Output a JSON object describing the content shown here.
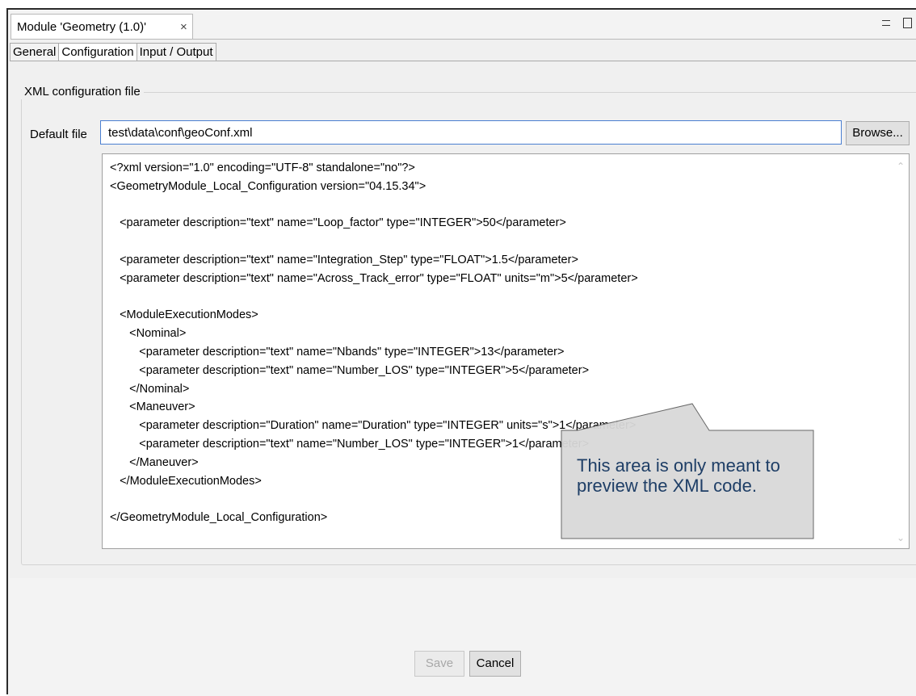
{
  "editor": {
    "tab_title": "Module 'Geometry (1.0)'",
    "close_symbol": "×"
  },
  "subtabs": [
    {
      "label": "General",
      "active": false
    },
    {
      "label": "Configuration",
      "active": true
    },
    {
      "label": "Input / Output",
      "active": false
    }
  ],
  "config": {
    "group_title": "XML configuration file",
    "default_file_label": "Default file",
    "default_file_value": "test\\data\\conf\\geoConf.xml",
    "browse_label": "Browse..."
  },
  "xml_preview": {
    "lines": [
      "<?xml version=\"1.0\" encoding=\"UTF-8\" standalone=\"no\"?>",
      "<GeometryModule_Local_Configuration version=\"04.15.34\">",
      "",
      "   <parameter description=\"text\" name=\"Loop_factor\" type=\"INTEGER\">50</parameter>",
      "",
      "   <parameter description=\"text\" name=\"Integration_Step\" type=\"FLOAT\">1.5</parameter>",
      "   <parameter description=\"text\" name=\"Across_Track_error\" type=\"FLOAT\" units=\"m\">5</parameter>",
      "",
      "   <ModuleExecutionModes>",
      "      <Nominal>",
      "         <parameter description=\"text\" name=\"Nbands\" type=\"INTEGER\">13</parameter>",
      "         <parameter description=\"text\" name=\"Number_LOS\" type=\"INTEGER\">5</parameter>",
      "      </Nominal>",
      "      <Maneuver>",
      "         <parameter description=\"Duration\" name=\"Duration\" type=\"INTEGER\" units=\"s\">1</parameter>",
      "         <parameter description=\"text\" name=\"Number_LOS\" type=\"INTEGER\">1</parameter>",
      "      </Maneuver>",
      "   </ModuleExecutionModes>",
      "",
      "</GeometryModule_Local_Configuration>"
    ]
  },
  "callout": {
    "text": "This area is only meant to preview the XML code."
  },
  "buttons": {
    "save_label": "Save",
    "cancel_label": "Cancel"
  },
  "icons": {
    "minimize": "minimize-icon",
    "maximize": "maximize-icon",
    "scroll_up": "scroll-up-arrow-icon",
    "scroll_down": "scroll-down-arrow-icon"
  },
  "colors": {
    "focus_border": "#4a7fd1",
    "callout_fill": "#d9d9d9",
    "callout_text": "#1e3e66"
  }
}
